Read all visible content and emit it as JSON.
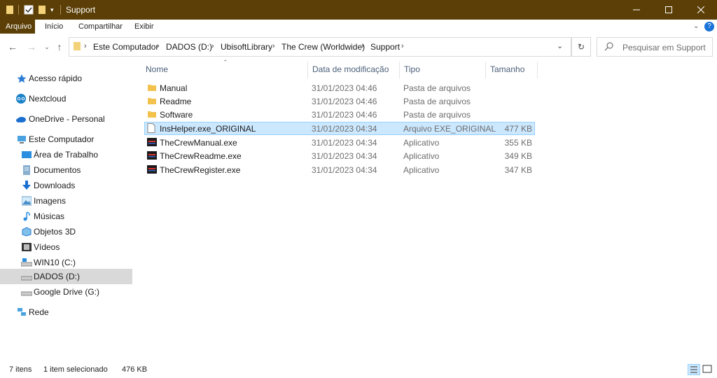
{
  "window": {
    "title": "Support",
    "controls": [
      "minimize-icon",
      "maximize-icon",
      "close-icon"
    ],
    "accent": "#5b3f06"
  },
  "ribbon": {
    "tabs": [
      "Arquivo",
      "Início",
      "Compartilhar",
      "Exibir"
    ]
  },
  "address": {
    "crumbs": [
      "Este Computador",
      "DADOS (D:)",
      "UbisoftLibrary",
      "The Crew (Worldwide)",
      "Support"
    ]
  },
  "search": {
    "placeholder": "Pesquisar em Support"
  },
  "sidebar": {
    "items": [
      {
        "label": "Acesso rápido",
        "icon": "star-icon"
      },
      {
        "label": "Nextcloud",
        "icon": "nextcloud-icon"
      },
      {
        "label": "OneDrive - Personal",
        "icon": "cloud-icon"
      },
      {
        "label": "Este Computador",
        "icon": "computer-icon"
      },
      {
        "label": "Área de Trabalho",
        "icon": "desktop-icon"
      },
      {
        "label": "Documentos",
        "icon": "documents-icon"
      },
      {
        "label": "Downloads",
        "icon": "download-icon"
      },
      {
        "label": "Imagens",
        "icon": "pictures-icon"
      },
      {
        "label": "Músicas",
        "icon": "music-icon"
      },
      {
        "label": "Objetos 3D",
        "icon": "3d-objects-icon"
      },
      {
        "label": "Vídeos",
        "icon": "videos-icon"
      },
      {
        "label": "WIN10 (C:)",
        "icon": "drive-icon"
      },
      {
        "label": "DADOS (D:)",
        "icon": "drive-icon",
        "selected": true
      },
      {
        "label": "Google Drive (G:)",
        "icon": "drive-icon"
      },
      {
        "label": "Rede",
        "icon": "network-icon"
      }
    ]
  },
  "columns": {
    "name": "Nome",
    "date": "Data de modificação",
    "type": "Tipo",
    "size": "Tamanho"
  },
  "files": [
    {
      "name": "Manual",
      "date": "31/01/2023 04:46",
      "type": "Pasta de arquivos",
      "size": "",
      "icon": "folder-icon"
    },
    {
      "name": "Readme",
      "date": "31/01/2023 04:46",
      "type": "Pasta de arquivos",
      "size": "",
      "icon": "folder-icon"
    },
    {
      "name": "Software",
      "date": "31/01/2023 04:46",
      "type": "Pasta de arquivos",
      "size": "",
      "icon": "folder-icon"
    },
    {
      "name": "InsHelper.exe_ORIGINAL",
      "date": "31/01/2023 04:34",
      "type": "Arquivo EXE_ORIGINAL",
      "size": "477 KB",
      "icon": "file-icon",
      "selected": true
    },
    {
      "name": "TheCrewManual.exe",
      "date": "31/01/2023 04:34",
      "type": "Aplicativo",
      "size": "355 KB",
      "icon": "app-icon"
    },
    {
      "name": "TheCrewReadme.exe",
      "date": "31/01/2023 04:34",
      "type": "Aplicativo",
      "size": "349 KB",
      "icon": "app-icon"
    },
    {
      "name": "TheCrewRegister.exe",
      "date": "31/01/2023 04:34",
      "type": "Aplicativo",
      "size": "347 KB",
      "icon": "app-icon"
    }
  ],
  "status": {
    "count": "7 itens",
    "selection": "1 item selecionado",
    "size": "476 KB"
  }
}
